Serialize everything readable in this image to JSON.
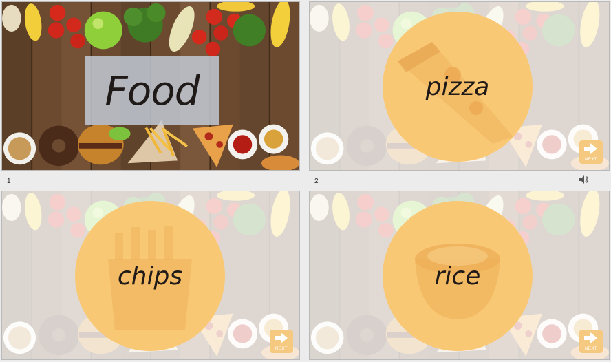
{
  "slides": [
    {
      "number": "1",
      "title": "Food"
    },
    {
      "number": "2",
      "word": "pizza",
      "icon": "pizza-slice"
    },
    {
      "number": "",
      "word": "chips",
      "icon": "fries-box"
    },
    {
      "number": "",
      "word": "rice",
      "icon": "rice-bowl"
    }
  ],
  "next_button": {
    "label": "NEXT",
    "icon": "arrow-right-icon"
  },
  "audio": {
    "icon": "speaker-icon"
  },
  "colors": {
    "circle": "#f9c874",
    "title_box": "#c4cedc",
    "next_button": "#f6c980",
    "wood": "#6b4a2f"
  }
}
